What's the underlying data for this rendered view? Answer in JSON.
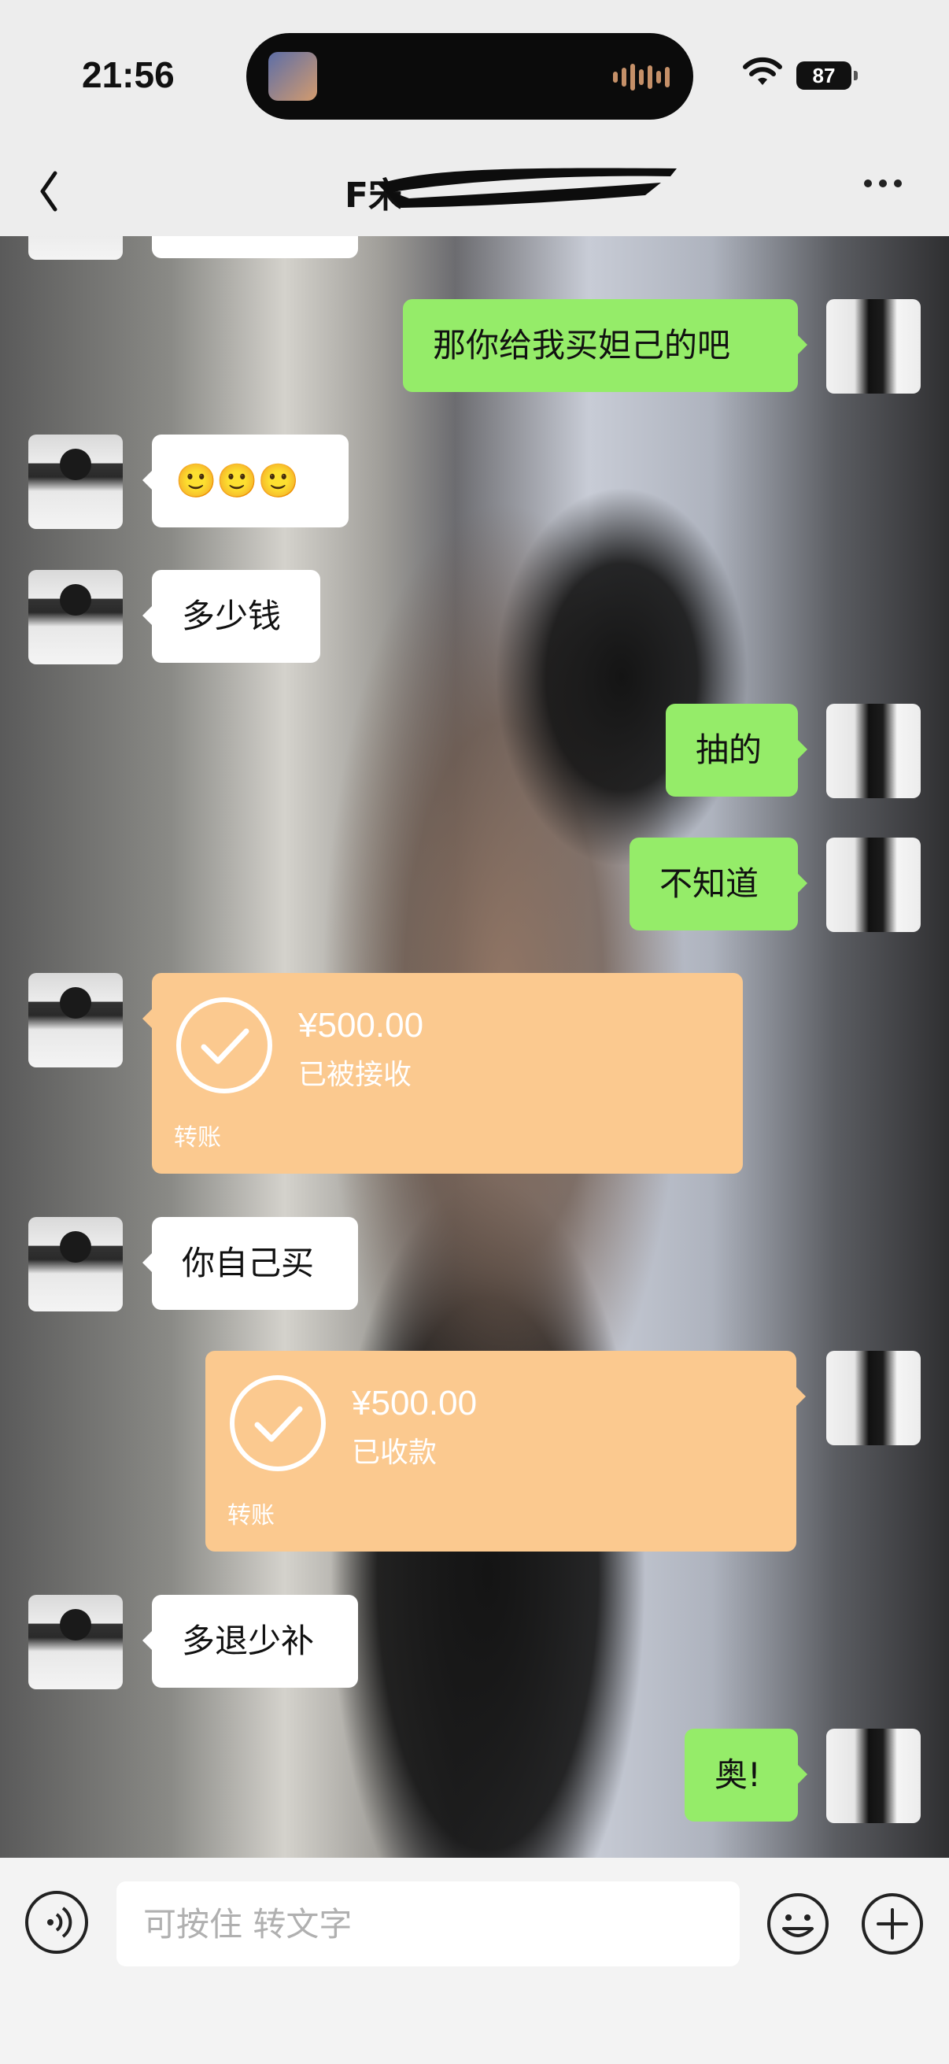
{
  "status_bar": {
    "time": "21:56",
    "battery": "87"
  },
  "navbar": {
    "title": "F宋"
  },
  "messages": [
    {
      "side": "right",
      "type": "text",
      "text": "那你给我买妲己的吧"
    },
    {
      "side": "left",
      "type": "emoji",
      "text": "🙂🙂🙂"
    },
    {
      "side": "left",
      "type": "text",
      "text": "多少钱"
    },
    {
      "side": "right",
      "type": "text",
      "text": "抽的"
    },
    {
      "side": "right",
      "type": "text",
      "text": "不知道"
    },
    {
      "side": "left",
      "type": "transfer",
      "amount": "¥500.00",
      "status": "已被接收",
      "label": "转账"
    },
    {
      "side": "left",
      "type": "text",
      "text": "你自己买"
    },
    {
      "side": "right",
      "type": "transfer",
      "amount": "¥500.00",
      "status": "已收款",
      "label": "转账"
    },
    {
      "side": "left",
      "type": "text",
      "text": "多退少补"
    },
    {
      "side": "right",
      "type": "text",
      "text": "奥!"
    }
  ],
  "input_bar": {
    "placeholder": "可按住 转文字"
  },
  "colors": {
    "bar_bg": "#ededed",
    "bubble_right": "#95ec69",
    "bubble_left": "#ffffff",
    "transfer": "#fbc98f"
  }
}
